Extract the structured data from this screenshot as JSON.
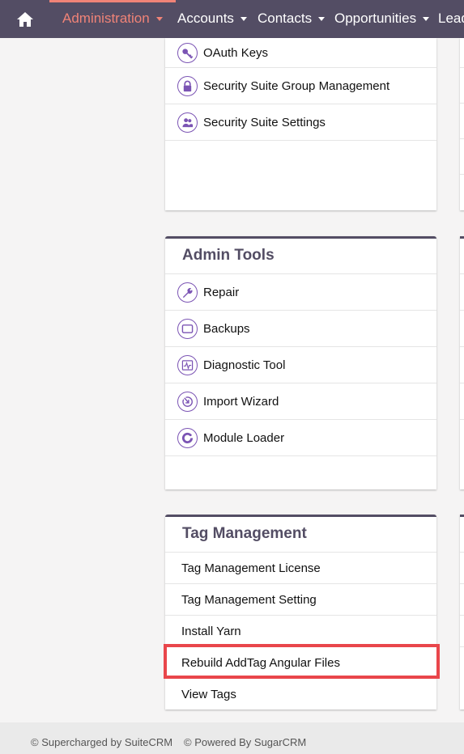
{
  "nav": {
    "items": [
      {
        "label": "Administration",
        "active": true
      },
      {
        "label": "Accounts"
      },
      {
        "label": "Contacts"
      },
      {
        "label": "Opportunities"
      },
      {
        "label": "Leads"
      }
    ]
  },
  "panel_security": {
    "items": [
      {
        "label": "OAuth Keys",
        "icon": "key-icon"
      },
      {
        "label": "Security Suite Group Management",
        "icon": "lock-icon"
      },
      {
        "label": "Security Suite Settings",
        "icon": "users-icon"
      }
    ]
  },
  "panel_admin_tools": {
    "title": "Admin Tools",
    "items": [
      {
        "label": "Repair",
        "icon": "wrench-icon"
      },
      {
        "label": "Backups",
        "icon": "backup-icon"
      },
      {
        "label": "Diagnostic Tool",
        "icon": "diagnostic-icon"
      },
      {
        "label": "Import Wizard",
        "icon": "import-icon"
      },
      {
        "label": "Module Loader",
        "icon": "module-loader-icon"
      }
    ]
  },
  "panel_tag_management": {
    "title": "Tag Management",
    "items": [
      {
        "label": "Tag Management License"
      },
      {
        "label": "Tag Management Setting"
      },
      {
        "label": "Install Yarn"
      },
      {
        "label": "Rebuild AddTag Angular Files"
      },
      {
        "label": "View Tags"
      }
    ]
  },
  "footer": {
    "suitecrm": "© Supercharged by SuiteCRM",
    "sugarcrm": "© Powered By SugarCRM"
  },
  "colors": {
    "nav_bg": "#534d64",
    "accent": "#f08377",
    "icon": "#7b54b4",
    "highlight": "#e9464b"
  }
}
